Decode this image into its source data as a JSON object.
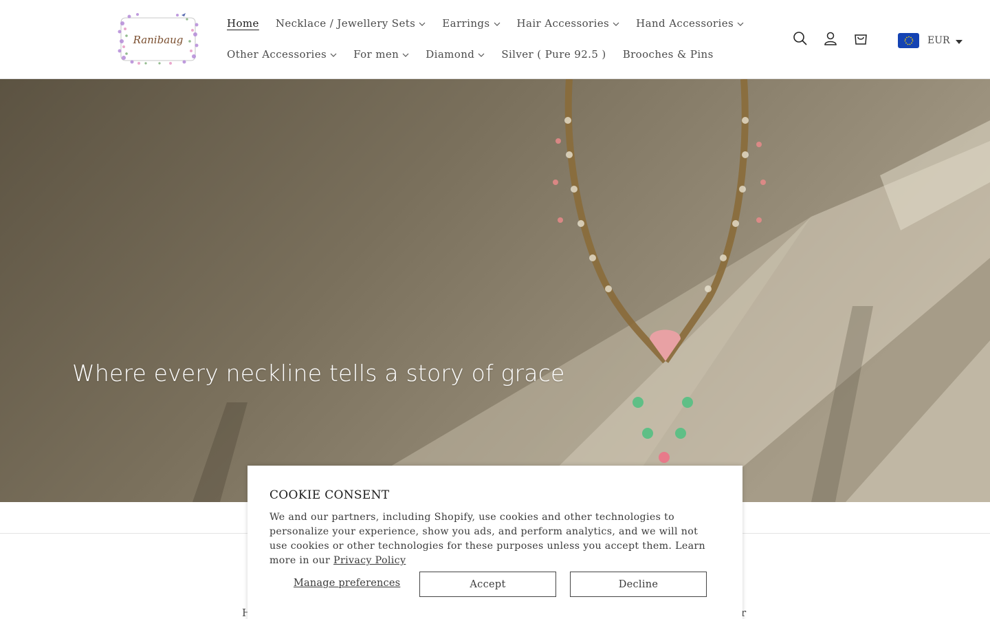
{
  "header": {
    "logo_text": "Ranibaug",
    "nav_row1": [
      {
        "label": "Home",
        "active": true,
        "has_dropdown": false
      },
      {
        "label": "Necklace / Jewellery Sets",
        "has_dropdown": true
      },
      {
        "label": "Earrings",
        "has_dropdown": true
      },
      {
        "label": "Hair Accessories",
        "has_dropdown": true
      },
      {
        "label": "Hand Accessories",
        "has_dropdown": true
      }
    ],
    "nav_row2": [
      {
        "label": "Other Accessories",
        "has_dropdown": true
      },
      {
        "label": "For men",
        "has_dropdown": true
      },
      {
        "label": "Diamond",
        "has_dropdown": true
      },
      {
        "label": "Silver ( Pure 92.5 )",
        "has_dropdown": false
      },
      {
        "label": "Brooches & Pins",
        "has_dropdown": false
      }
    ],
    "icons": [
      "search-icon",
      "account-icon",
      "cart-icon"
    ],
    "currency": {
      "code": "EUR",
      "flag": "eu-flag-icon"
    }
  },
  "hero": {
    "tagline": "Where every neckline tells a story of grace"
  },
  "below": {
    "left_fragment": "H",
    "right_fragment": "r"
  },
  "cookie": {
    "title": "COOKIE CONSENT",
    "body": "We and our partners, including Shopify, use cookies and other technologies to personalize your experience, show you ads, and perform analytics, and we will not use cookies or other technologies for these purposes unless you accept them. Learn more in our ",
    "link": "Privacy Policy",
    "manage_label": "Manage preferences",
    "accept_label": "Accept",
    "decline_label": "Decline"
  },
  "colors": {
    "text": "#4a4a4a",
    "border": "#e4e4e4",
    "flag_blue": "#1443b3"
  }
}
